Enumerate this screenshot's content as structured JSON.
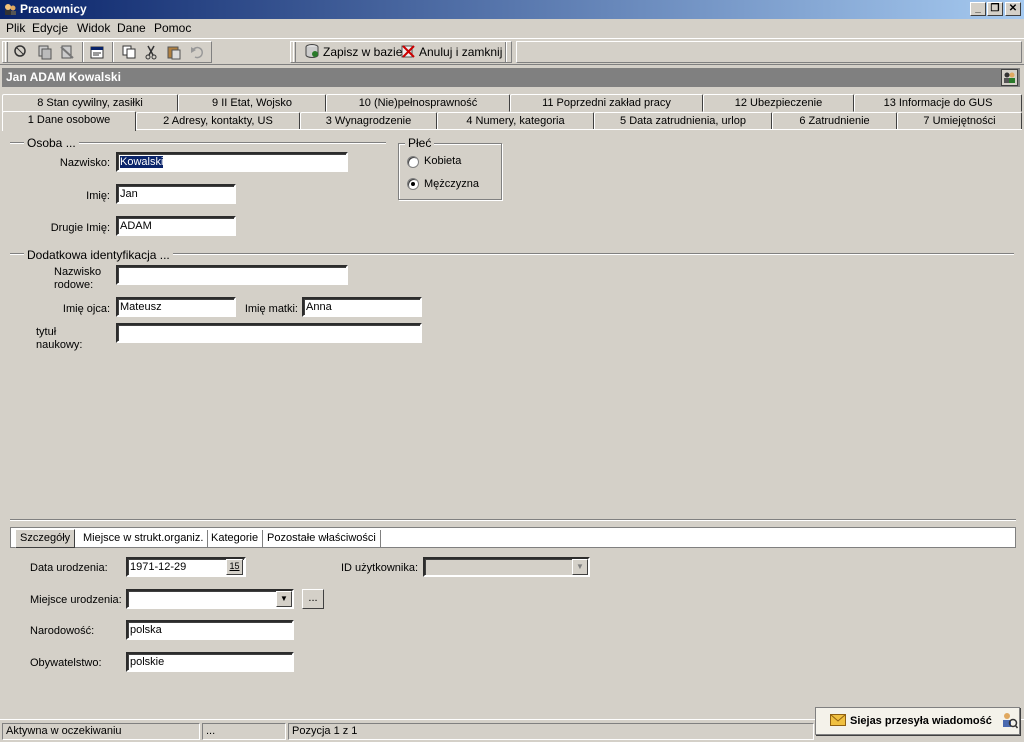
{
  "window": {
    "title": "Pracownicy",
    "controls": {
      "minimize": "_",
      "restore": "❐",
      "close": "✕"
    }
  },
  "menu": [
    "Plik",
    "Edycje",
    "Widok",
    "Dane",
    "Pomoc"
  ],
  "toolbar": {
    "save_label": "Zapisz w bazie",
    "cancel_label": "Anuluj i zamknij"
  },
  "header": {
    "title": "Jan ADAM Kowalski"
  },
  "tabs_row1": [
    "8 Stan cywilny, zasiłki",
    "9 II Etat, Wojsko",
    "10 (Nie)pełnosprawność",
    "11 Poprzedni zakład pracy",
    "12 Ubezpieczenie",
    "13 Informacje do GUS"
  ],
  "tabs_row2": [
    "1 Dane osobowe",
    "2 Adresy, kontakty, US",
    "3 Wynagrodzenie",
    "4 Numery, kategoria",
    "5 Data zatrudnienia, urlop",
    "6 Zatrudnienie",
    "7 Umiejętności"
  ],
  "osoba": {
    "legend": "Osoba ...",
    "nazwisko_label": "Nazwisko:",
    "nazwisko": "Kowalski",
    "imie_label": "Imię:",
    "imie": "Jan",
    "drugie_imie_label": "Drugie Imię:",
    "drugie_imie": "ADAM"
  },
  "plec": {
    "legend": "Płeć",
    "kobieta": "Kobieta",
    "mezczyzna": "Mężczyzna",
    "selected": "Mężczyzna"
  },
  "dodatkowa": {
    "legend": "Dodatkowa identyfikacja ...",
    "nazwisko_rodowe_label_1": "Nazwisko",
    "nazwisko_rodowe_label_2": "rodowe:",
    "nazwisko_rodowe": "",
    "imie_ojca_label": "Imię ojca:",
    "imie_ojca": "Mateusz",
    "imie_matki_label": "Imię matki:",
    "imie_matki": "Anna",
    "tytul_label_1": "tytuł",
    "tytul_label_2": "naukowy:",
    "tytul": ""
  },
  "lower_tabs": [
    "Szczegóły",
    "Miejsce w strukt.organiz.",
    "Kategorie",
    "Pozostałe właściwości"
  ],
  "szczegoly": {
    "data_urodzenia_label": "Data urodzenia:",
    "data_urodzenia": "1971-12-29",
    "calendar_day": "15",
    "id_uzytkownika_label": "ID użytkownika:",
    "id_uzytkownika": "",
    "miejsce_urodzenia_label": "Miejsce urodzenia:",
    "miejsce_urodzenia": "",
    "more_button": "...",
    "narodowosc_label": "Narodowość:",
    "narodowosc": "polska",
    "obywatelstwo_label": "Obywatelstwo:",
    "obywatelstwo": "polskie"
  },
  "status": {
    "state": "Aktywna w oczekiwaniu",
    "dots": "...",
    "position": "Pozycja 1 z 1"
  },
  "notification": {
    "text": "Siejas przesyła wiadomość"
  },
  "colors": {
    "titlebar_start": "#0a246a",
    "titlebar_end": "#a6caf0",
    "face": "#d4d0c8",
    "header_strip": "#808080",
    "selection": "#0a246a"
  }
}
